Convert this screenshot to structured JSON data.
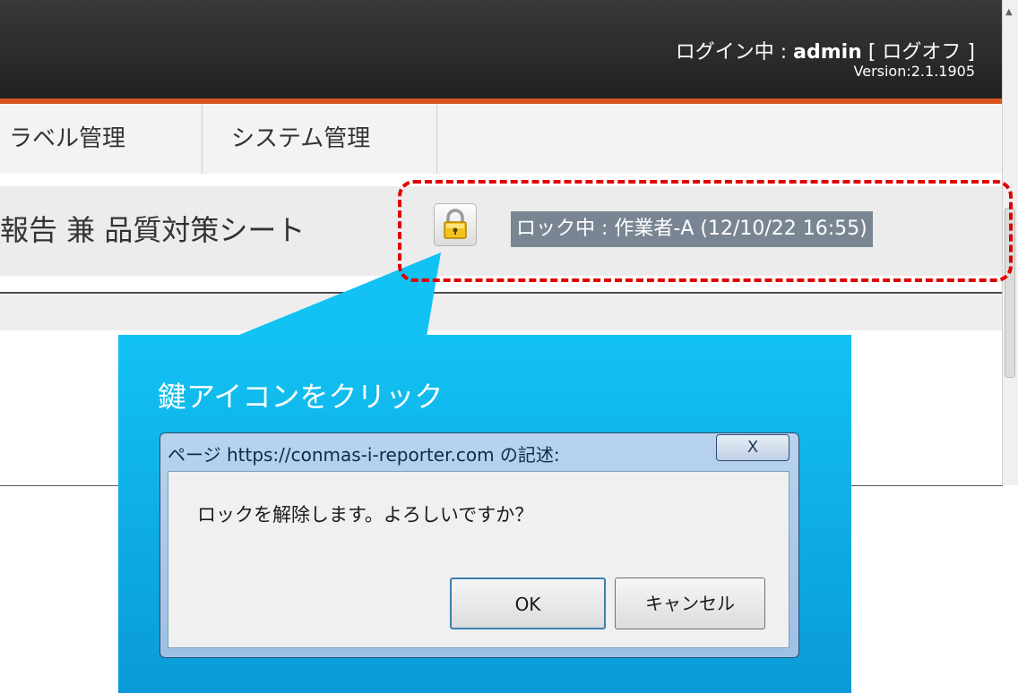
{
  "header": {
    "login_prefix": "ログイン中 : ",
    "user": "admin",
    "logout": "[ ログオフ ]",
    "version": "Version:2.1.1905"
  },
  "nav": {
    "items": [
      {
        "label": "ラベル管理"
      },
      {
        "label": "システム管理"
      }
    ]
  },
  "sheet": {
    "title": "報告 兼 品質対策シート",
    "lock_status": "ロック中 : 作業者-A (12/10/22 16:55)"
  },
  "callout": {
    "text": "鍵アイコンをクリック"
  },
  "dialog": {
    "title": "ページ https://conmas-i-reporter.com の記述:",
    "close_label": "X",
    "message": "ロックを解除します。よろしいですか？",
    "ok_label": "OK",
    "cancel_label": "キャンセル"
  },
  "colors": {
    "header_bg": "#2a2a2a",
    "accent_orange": "#d9531e",
    "highlight_red": "#e00000",
    "callout_blue": "#0aa6e4",
    "lock_badge_bg": "#7a8594"
  },
  "icons": {
    "lock": "lock-icon",
    "scroll_up": "scroll-up-arrow-icon",
    "close": "close-icon"
  }
}
